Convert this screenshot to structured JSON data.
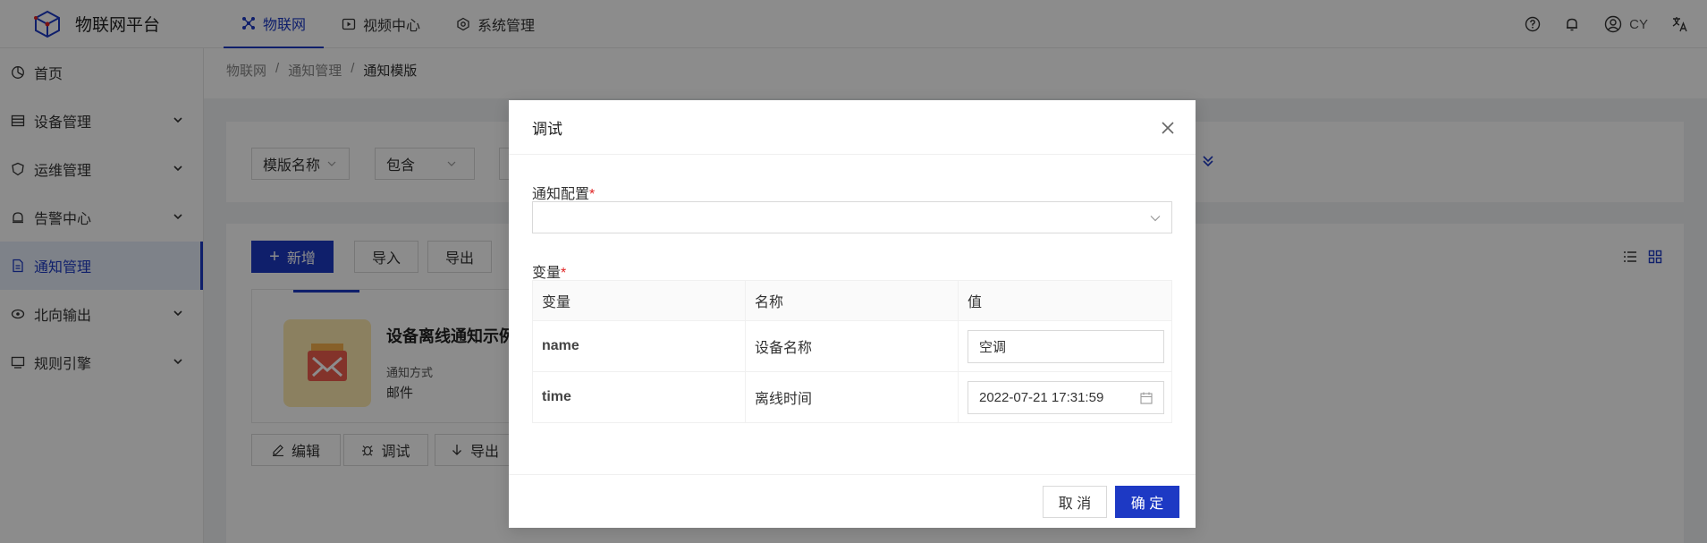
{
  "header": {
    "app_title": "物联网平台",
    "nav": [
      {
        "label": "物联网",
        "icon": "iot-icon",
        "active": true
      },
      {
        "label": "视频中心",
        "icon": "video-icon",
        "active": false
      },
      {
        "label": "系统管理",
        "icon": "system-icon",
        "active": false
      }
    ],
    "user_name": "CY"
  },
  "sidebar": {
    "items": [
      {
        "label": "首页",
        "icon": "dashboard-icon",
        "expandable": false
      },
      {
        "label": "设备管理",
        "icon": "device-icon",
        "expandable": true
      },
      {
        "label": "运维管理",
        "icon": "ops-icon",
        "expandable": true
      },
      {
        "label": "告警中心",
        "icon": "alarm-icon",
        "expandable": true
      },
      {
        "label": "通知管理",
        "icon": "notice-icon",
        "expandable": false,
        "active": true
      },
      {
        "label": "北向输出",
        "icon": "output-icon",
        "expandable": true
      },
      {
        "label": "规则引擎",
        "icon": "rule-icon",
        "expandable": true
      }
    ]
  },
  "breadcrumb": [
    "物联网",
    "通知管理",
    "通知模版"
  ],
  "breadcrumb_sep": "/",
  "search": {
    "field_label": "模版名称",
    "operator_label": "包含"
  },
  "toolbar": {
    "add_label": "新增",
    "import_label": "导入",
    "export_label": "导出"
  },
  "card": {
    "title": "设备离线通知示例",
    "method_label": "通知方式",
    "method_value": "邮件",
    "actions": [
      "编辑",
      "调试",
      "导出"
    ]
  },
  "modal": {
    "title": "调试",
    "config_label": "通知配置",
    "variables_label": "变量",
    "required_mark": "*",
    "table": {
      "headers": [
        "变量",
        "名称",
        "值"
      ],
      "rows": [
        {
          "code": "name",
          "name": "设备名称",
          "value": "空调"
        },
        {
          "code": "time",
          "name": "离线时间",
          "value": "2022-07-21 17:31:59"
        }
      ]
    },
    "cancel_label": "取 消",
    "confirm_label": "确 定"
  },
  "colors": {
    "primary": "#1d39c4",
    "required": "#e02424",
    "mask": "rgba(0,0,0,0.45)"
  }
}
